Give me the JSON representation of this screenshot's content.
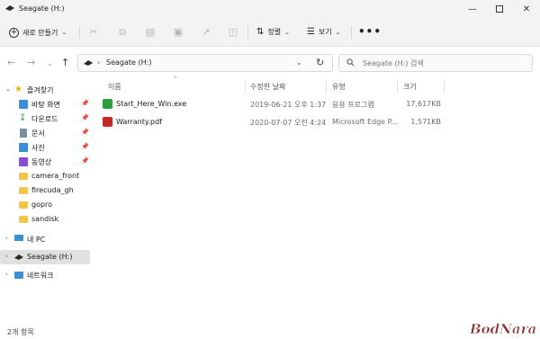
{
  "window": {
    "title": "Seagate (H:)"
  },
  "toolbar": {
    "new_label": "새로 만들기",
    "sort_label": "정렬",
    "view_label": "보기",
    "more_label": "•••"
  },
  "address": {
    "path": "Seagate (H:)"
  },
  "search": {
    "placeholder": "Seagate (H:) 검색"
  },
  "sidebar": {
    "items": [
      {
        "label": "즐겨찾기"
      },
      {
        "label": "바탕 화면"
      },
      {
        "label": "다운로드"
      },
      {
        "label": "문서"
      },
      {
        "label": "사진"
      },
      {
        "label": "동영상"
      },
      {
        "label": "camera_front"
      },
      {
        "label": "firecuda_gh"
      },
      {
        "label": "gopro"
      },
      {
        "label": "sandisk"
      },
      {
        "label": "내 PC"
      },
      {
        "label": "Seagate (H:)"
      },
      {
        "label": "네트워크"
      }
    ]
  },
  "columns": {
    "name": "이름",
    "modified": "수정한 날짜",
    "type": "유형",
    "size": "크기"
  },
  "files": [
    {
      "name": "Start_Here_Win.exe",
      "modified": "2019-06-21 오후 1:37",
      "type": "응용 프로그램",
      "size": "17,617KB",
      "icon": "exe-icon"
    },
    {
      "name": "Warranty.pdf",
      "modified": "2020-07-07 오전 4:24",
      "type": "Microsoft Edge P...",
      "size": "1,571KB",
      "icon": "pdf-icon"
    }
  ],
  "status": {
    "count": "2개 항목"
  },
  "watermark": {
    "text": "BodNara"
  },
  "colors": {
    "folder": "#f3c54d",
    "selection": "#e0e0e0",
    "accent": "#2f6fc2",
    "pdf": "#c62828",
    "exe": "#2e9e3a"
  }
}
